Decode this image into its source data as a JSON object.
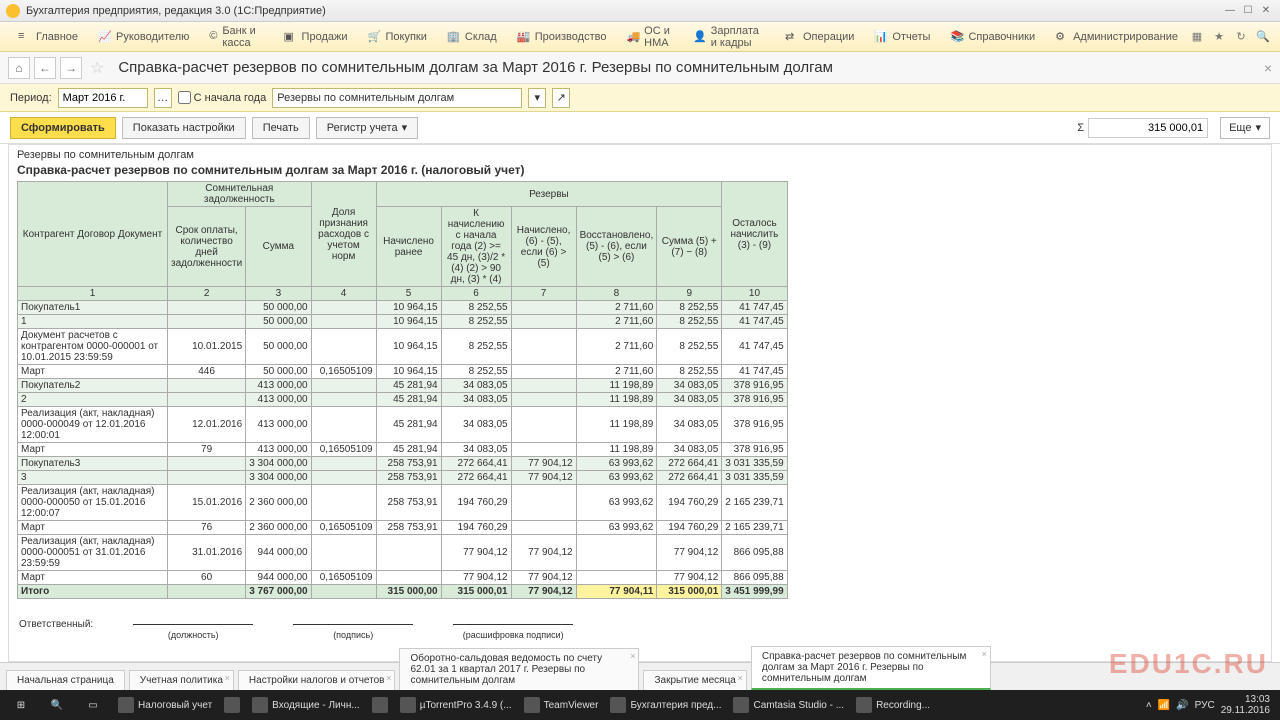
{
  "title": "Бухгалтерия предприятия, редакция 3.0  (1С:Предприятие)",
  "menu": {
    "main": "Главное",
    "ruk": "Руководителю",
    "bank": "Банк и касса",
    "prod": "Продажи",
    "pok": "Покупки",
    "sklad": "Склад",
    "proizv": "Производство",
    "os": "ОС и НМА",
    "zp": "Зарплата и кадры",
    "oper": "Операции",
    "otch": "Отчеты",
    "sprav": "Справочники",
    "admin": "Администрирование"
  },
  "page_title": "Справка-расчет резервов по сомнительным долгам за Март 2016 г. Резервы по сомнительным долгам",
  "params": {
    "period_label": "Период:",
    "period_value": "Март 2016 г.",
    "since_start": "С начала года",
    "sel": "Резервы по сомнительным долгам"
  },
  "toolbar": {
    "form": "Сформировать",
    "settings": "Показать настройки",
    "print": "Печать",
    "reg": "Регистр учета",
    "sum_sym": "Σ",
    "sum_val": "315 000,01",
    "more": "Еще"
  },
  "report": {
    "h1": "Резервы по сомнительным долгам",
    "h2": "Справка-расчет резервов по сомнительным долгам за Март 2016 г. (налоговый учет)",
    "cols": {
      "c1": "Контрагент\nДоговор\nДокумент",
      "g1": "Сомнительная задолженность",
      "c2": "Срок оплаты, количество дней задолженности",
      "c3": "Сумма",
      "c4": "Доля признания расходов с учетом норм",
      "g2": "Резервы",
      "c5": "Начислено ранее",
      "c6": "К начислению с начала года\n(2) >= 45 дн, (3)/2 * (4)\n(2) > 90 дн, (3) * (4)",
      "c7": "Начислено,\n(6) - (5),\nесли (6) > (5)",
      "c8": "Восстановлено,\n(5) - (6),\nесли (5) > (6)",
      "c9": "Сумма\n(5) + (7) − (8)",
      "c10": "Осталось начислить\n(3) - (9)"
    },
    "colnums": [
      "1",
      "2",
      "3",
      "4",
      "5",
      "6",
      "7",
      "8",
      "9",
      "10"
    ],
    "rows": [
      {
        "cls": "grp",
        "c": [
          "Покупатель1",
          "",
          "50 000,00",
          "",
          "10 964,15",
          "8 252,55",
          "",
          "2 711,60",
          "8 252,55",
          "41 747,45"
        ]
      },
      {
        "cls": "grp",
        "c": [
          "1",
          "",
          "50 000,00",
          "",
          "10 964,15",
          "8 252,55",
          "",
          "2 711,60",
          "8 252,55",
          "41 747,45"
        ]
      },
      {
        "c": [
          "Документ расчетов с контрагентом 0000-000001 от 10.01.2015 23:59:59",
          "10.01.2015",
          "50 000,00",
          "",
          "10 964,15",
          "8 252,55",
          "",
          "2 711,60",
          "8 252,55",
          "41 747,45"
        ]
      },
      {
        "c": [
          "Март",
          "446",
          "50 000,00",
          "0,16505109",
          "10 964,15",
          "8 252,55",
          "",
          "2 711,60",
          "8 252,55",
          "41 747,45"
        ]
      },
      {
        "cls": "grp",
        "c": [
          "Покупатель2",
          "",
          "413 000,00",
          "",
          "45 281,94",
          "34 083,05",
          "",
          "11 198,89",
          "34 083,05",
          "378 916,95"
        ]
      },
      {
        "cls": "grp",
        "c": [
          "2",
          "",
          "413 000,00",
          "",
          "45 281,94",
          "34 083,05",
          "",
          "11 198,89",
          "34 083,05",
          "378 916,95"
        ]
      },
      {
        "c": [
          "Реализация (акт, накладная) 0000-000049 от 12.01.2016 12:00:01",
          "12.01.2016",
          "413 000,00",
          "",
          "45 281,94",
          "34 083,05",
          "",
          "11 198,89",
          "34 083,05",
          "378 916,95"
        ]
      },
      {
        "c": [
          "Март",
          "79",
          "413 000,00",
          "0,16505109",
          "45 281,94",
          "34 083,05",
          "",
          "11 198,89",
          "34 083,05",
          "378 916,95"
        ]
      },
      {
        "cls": "grp",
        "c": [
          "Покупатель3",
          "",
          "3 304 000,00",
          "",
          "258 753,91",
          "272 664,41",
          "77 904,12",
          "63 993,62",
          "272 664,41",
          "3 031 335,59"
        ]
      },
      {
        "cls": "grp",
        "c": [
          "3",
          "",
          "3 304 000,00",
          "",
          "258 753,91",
          "272 664,41",
          "77 904,12",
          "63 993,62",
          "272 664,41",
          "3 031 335,59"
        ]
      },
      {
        "c": [
          "Реализация (акт, накладная) 0000-000050 от 15.01.2016 12:00:07",
          "15.01.2016",
          "2 360 000,00",
          "",
          "258 753,91",
          "194 760,29",
          "",
          "63 993,62",
          "194 760,29",
          "2 165 239,71"
        ]
      },
      {
        "c": [
          "Март",
          "76",
          "2 360 000,00",
          "0,16505109",
          "258 753,91",
          "194 760,29",
          "",
          "63 993,62",
          "194 760,29",
          "2 165 239,71"
        ]
      },
      {
        "c": [
          "Реализация (акт, накладная) 0000-000051 от 31.01.2016 23:59:59",
          "31.01.2016",
          "944 000,00",
          "",
          "",
          "77 904,12",
          "77 904,12",
          "",
          "77 904,12",
          "866 095,88"
        ]
      },
      {
        "c": [
          "Март",
          "60",
          "944 000,00",
          "0,16505109",
          "",
          "77 904,12",
          "77 904,12",
          "",
          "77 904,12",
          "866 095,88"
        ]
      },
      {
        "cls": "total hi",
        "c": [
          "Итого",
          "",
          "3 767 000,00",
          "",
          "315 000,00",
          "315 000,01",
          "77 904,12",
          "77 904,11",
          "315 000,01",
          "3 451 999,99"
        ]
      }
    ],
    "sig": {
      "resp": "Ответственный:",
      "s1": "(должность)",
      "s2": "(подпись)",
      "s3": "(расшифровка подписи)"
    }
  },
  "tabs": [
    "Начальная страница",
    "Учетная политика",
    "Настройки налогов и отчетов",
    "Оборотно-сальдовая ведомость по счету 62.01 за 1 квартал 2017 г. Резервы по сомнительным долгам",
    "Закрытие месяца",
    "Справка-расчет резервов по сомнительным долгам за Март 2016 г. Резервы по сомнительным долгам"
  ],
  "watermark": "EDU1C.RU",
  "taskbar": {
    "items": [
      "Налоговый учет",
      "",
      "Входящие - Личн...",
      "",
      "µTorrentPro 3.4.9 (...",
      "TeamViewer",
      "Бухгалтерия пред...",
      "Camtasia Studio - ...",
      "Recording..."
    ],
    "time": "13:03",
    "date": "29.11.2016",
    "lang": "РУС"
  }
}
